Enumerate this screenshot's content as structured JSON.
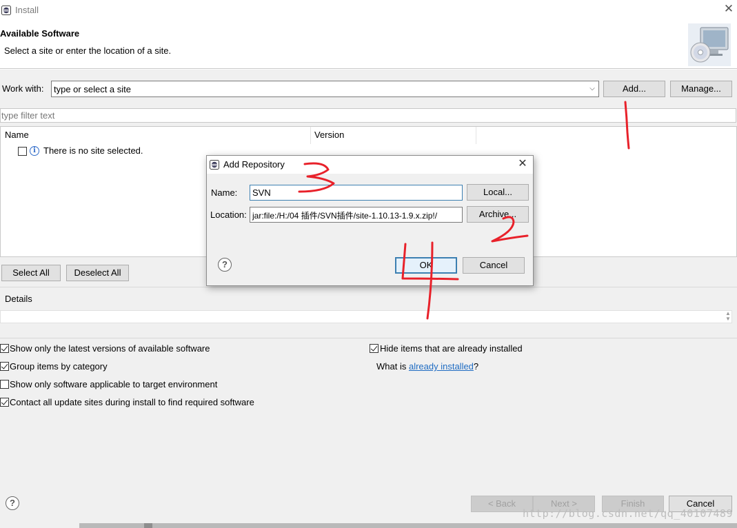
{
  "window": {
    "title": "Install",
    "close_glyph": "✕"
  },
  "header": {
    "title": "Available Software",
    "description": "Select a site or enter the location of a site.",
    "banner_icon": "install-cd-monitor-icon"
  },
  "work_with": {
    "label": "Work with:",
    "value": "type or select a site",
    "add_label": "Add...",
    "manage_label": "Manage..."
  },
  "filter": {
    "placeholder": "type filter text"
  },
  "tree": {
    "columns": [
      "Name",
      "Version"
    ],
    "rows": [
      {
        "label": "There is no site selected.",
        "checked": false
      }
    ]
  },
  "selection": {
    "select_all": "Select All",
    "deselect_all": "Deselect All"
  },
  "details": {
    "label": "Details"
  },
  "options": {
    "left": [
      {
        "label": "Show only the latest versions of available software",
        "checked": true
      },
      {
        "label": "Group items by category",
        "checked": true
      },
      {
        "label": "Show only software applicable to target environment",
        "checked": false
      },
      {
        "label": "Contact all update sites during install to find required software",
        "checked": true
      }
    ],
    "hide_installed": {
      "label": "Hide items that are already installed",
      "checked": true
    },
    "what_is": {
      "prefix": "What is ",
      "link": "already installed",
      "suffix": "?"
    }
  },
  "footer": {
    "back": "< Back",
    "next": "Next >",
    "finish": "Finish",
    "cancel": "Cancel"
  },
  "dialog": {
    "title": "Add Repository",
    "name_label": "Name:",
    "name_value": "SVN",
    "location_label": "Location:",
    "location_value": "jar:file:/H:/04 插件/SVN插件/site-1.10.13-1.9.x.zip!/",
    "local_label": "Local...",
    "archive_label": "Archive...",
    "ok_label": "OK",
    "cancel_label": "Cancel",
    "close_glyph": "✕"
  },
  "watermark": "http://blog.csdn.net/qq_40107489",
  "colors": {
    "annotation_red": "#e8212a",
    "link_blue": "#1e6bc2",
    "focus_blue": "#3c7fb1"
  }
}
